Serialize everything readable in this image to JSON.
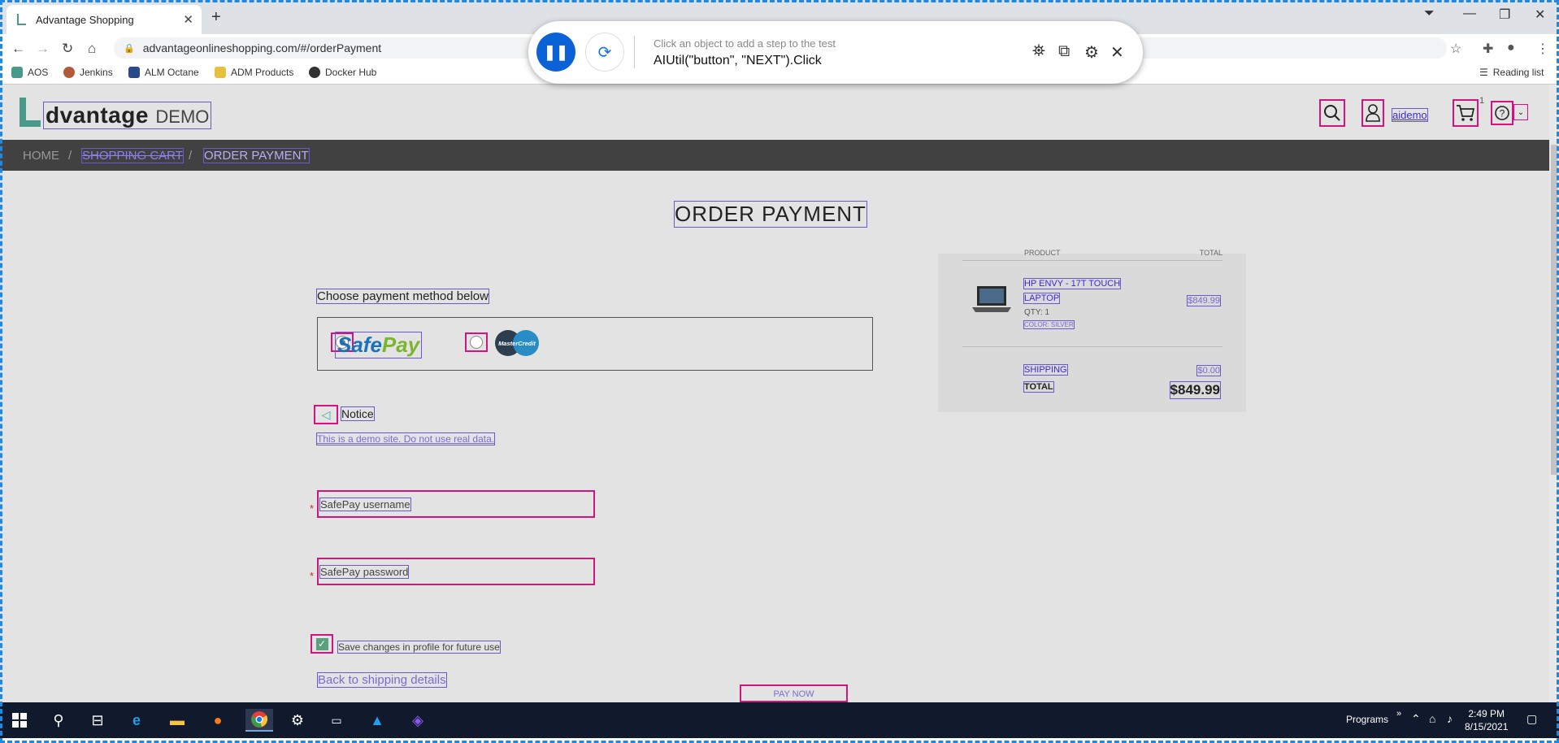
{
  "browser": {
    "tab_title": "Advantage Shopping",
    "new_tab": "+",
    "url": "advantageonlineshopping.com/#/orderPayment",
    "bookmarks": [
      {
        "label": "AOS",
        "icon": "aos-icon",
        "color": "#4a9a8a"
      },
      {
        "label": "Jenkins",
        "icon": "jenkins-icon",
        "color": "#b35a3a"
      },
      {
        "label": "ALM Octane",
        "icon": "octane-icon",
        "color": "#2a4a8a"
      },
      {
        "label": "ADM Products",
        "icon": "folder-icon",
        "color": "#e8c040"
      },
      {
        "label": "Docker Hub",
        "icon": "docker-icon",
        "color": "#333333"
      }
    ],
    "reading_list": "Reading list"
  },
  "recorder": {
    "hint": "Click an object to add a step to the test",
    "step": "AIUtil(\"button\", \"NEXT\").Click"
  },
  "site": {
    "logo_main": "dvantage",
    "logo_sub": "DEMO",
    "user": "aidemo",
    "cart_count": "1",
    "accent": "#d4147e",
    "bind_color": "#6a5acd"
  },
  "breadcrumb": {
    "home": "HOME",
    "sep": "/",
    "cart": "SHOPPING CART",
    "current": "ORDER PAYMENT"
  },
  "payment": {
    "title": "ORDER PAYMENT",
    "choose_label": "Choose payment method below",
    "safepay_a": "Safe",
    "safepay_b": "Pay",
    "mastercredit": "MasterCredit",
    "notice_title": "Notice",
    "notice_text": "This is a demo site. Do not use real data.",
    "required_mark": "*",
    "username_label": "SafePay username",
    "password_label": "SafePay password",
    "save_label": "Save changes in profile for future use",
    "back_link": "Back to shipping details",
    "pay_now": "PAY NOW"
  },
  "summary": {
    "header_product": "PRODUCT",
    "header_total": "TOTAL",
    "item_name_1": "HP ENVY - 17T TOUCH",
    "item_name_2": "LAPTOP",
    "item_qty": "QTY: 1",
    "item_color": "COLOR: SILVER",
    "item_price": "$849.99",
    "shipping_label": "SHIPPING",
    "shipping_value": "$0.00",
    "total_label": "TOTAL",
    "total_value": "$849.99"
  },
  "taskbar": {
    "programs": "Programs",
    "time": "2:49 PM",
    "date": "8/15/2021"
  }
}
